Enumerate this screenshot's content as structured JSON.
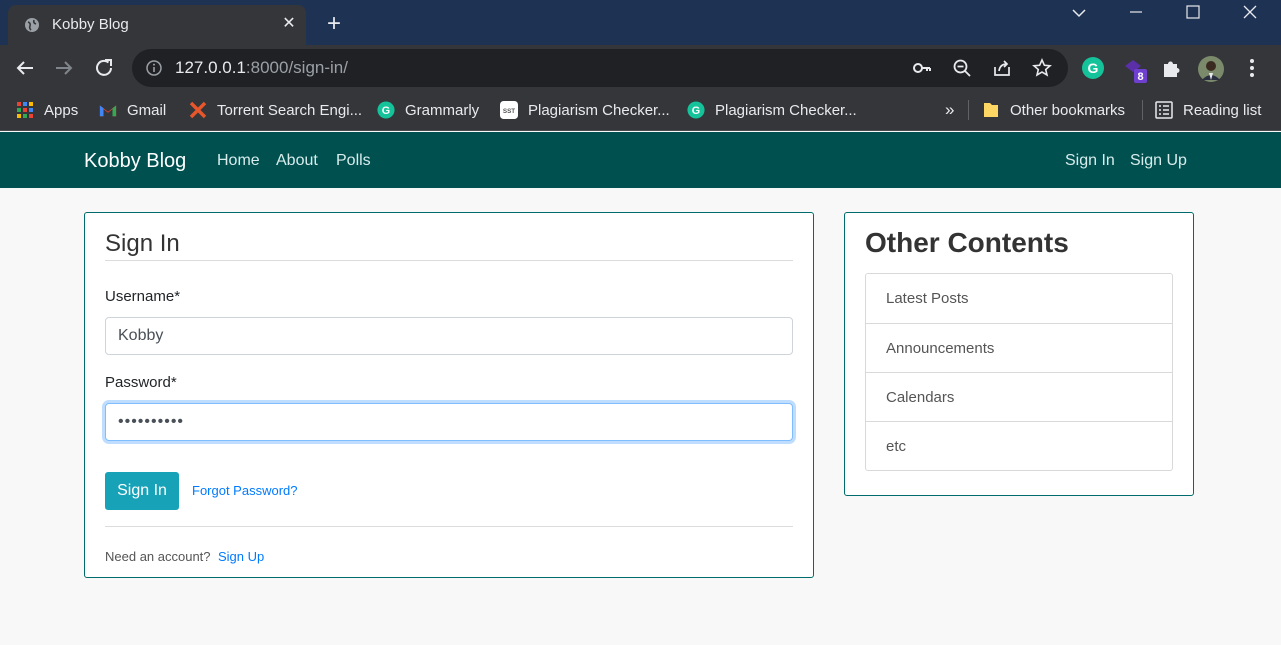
{
  "browser": {
    "tab_title": "Kobby Blog",
    "url_host": "127.0.0.1",
    "url_path": ":8000/sign-in/",
    "extension_badge": "8",
    "bookmarks": [
      {
        "label": "Apps",
        "icon": "apps-grid-icon"
      },
      {
        "label": "Gmail",
        "icon": "gmail-icon"
      },
      {
        "label": "Torrent Search Engi...",
        "icon": "torrent-x-icon"
      },
      {
        "label": "Grammarly",
        "icon": "grammarly-icon"
      },
      {
        "label": "Plagiarism Checker...",
        "icon": "sst-icon"
      },
      {
        "label": "Plagiarism Checker...",
        "icon": "grammarly-icon"
      }
    ],
    "bookmarks_overflow": "»",
    "other_bookmarks": "Other bookmarks",
    "reading_list": "Reading list"
  },
  "navbar": {
    "brand": "Kobby Blog",
    "links": [
      "Home",
      "About",
      "Polls"
    ],
    "sign_in": "Sign In",
    "sign_up": "Sign Up"
  },
  "login": {
    "title": "Sign In",
    "username_label": "Username*",
    "username_value": "Kobby",
    "password_label": "Password*",
    "password_value": "••••••••••",
    "submit": "Sign In",
    "forgot": "Forgot Password?",
    "need_account": "Need an account?",
    "sign_up_link": "Sign Up"
  },
  "sidebar": {
    "title": "Other Contents",
    "items": [
      "Latest Posts",
      "Announcements",
      "Calendars",
      "etc"
    ]
  },
  "colors": {
    "navbar": "#005050",
    "button": "#17a2b8",
    "link": "#007bff",
    "card_border": "#006b6b"
  }
}
